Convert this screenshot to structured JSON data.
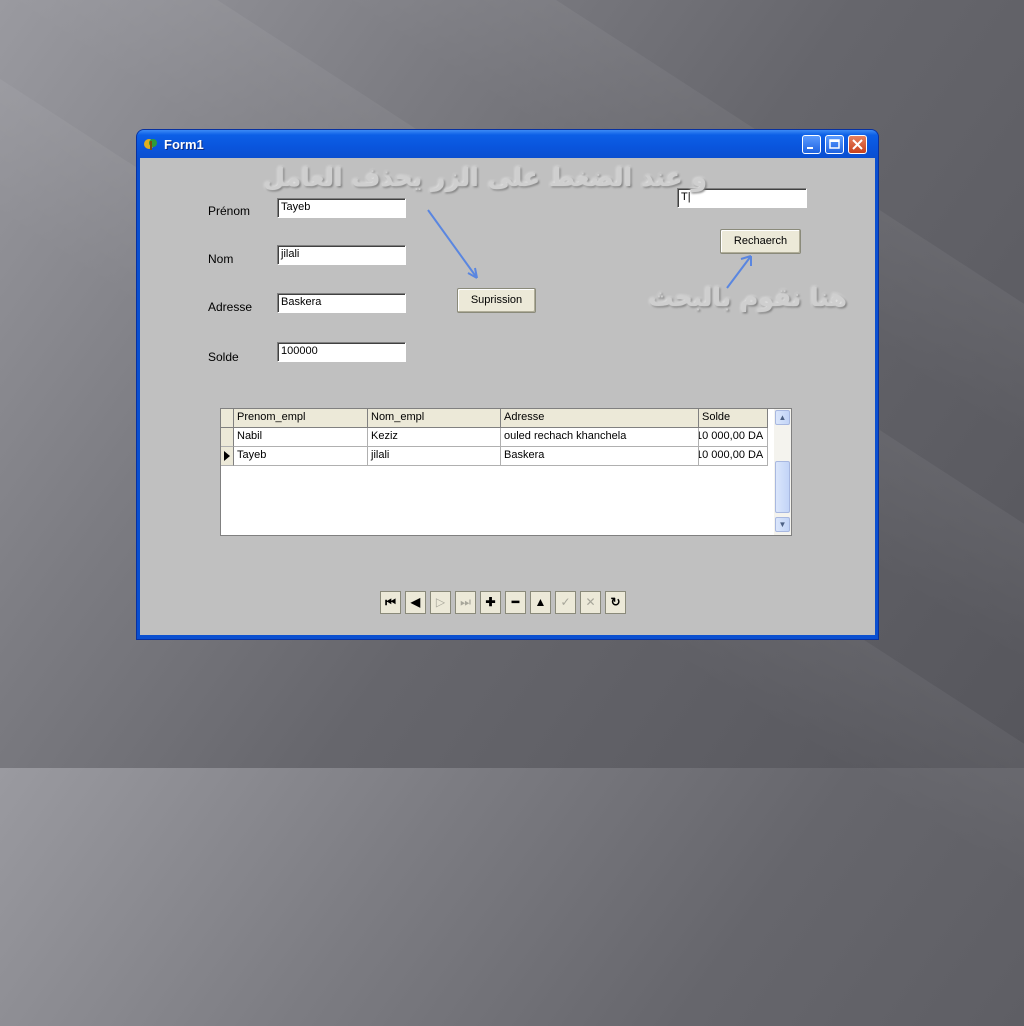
{
  "window": {
    "title": "Form1"
  },
  "form": {
    "prenom_label": "Prénom",
    "prenom_value": "Tayeb",
    "nom_label": "Nom",
    "nom_value": "jilali",
    "adresse_label": "Adresse",
    "adresse_value": "Baskera",
    "solde_label": "Solde",
    "solde_value": "100000",
    "search_value": "T|",
    "suprission_label": "Suprission",
    "recherche_label": "Rechaerch"
  },
  "annotations": {
    "delete_note": "و عند الضغط على الزر يحذف العامل",
    "search_note": "هنا نقوم بالبحث"
  },
  "grid": {
    "columns": [
      "Prenom_empl",
      "Nom_empl",
      "Adresse",
      "Solde"
    ],
    "rows": [
      {
        "prenom": "Nabil",
        "nom": "Keziz",
        "adresse": "ouled rechach khanchela",
        "solde": "10 000,00 DA",
        "current": false
      },
      {
        "prenom": "Tayeb",
        "nom": "jilali",
        "adresse": "Baskera",
        "solde": "10 000,00 DA",
        "current": true
      }
    ]
  },
  "navigator": {
    "buttons": [
      {
        "name": "nav-first-button",
        "glyph": "⏮",
        "enabled": true
      },
      {
        "name": "nav-prior-button",
        "glyph": "◀",
        "enabled": true
      },
      {
        "name": "nav-next-button",
        "glyph": "▷",
        "enabled": false
      },
      {
        "name": "nav-last-button",
        "glyph": "⏭",
        "enabled": false
      },
      {
        "name": "nav-insert-button",
        "glyph": "✚",
        "enabled": true
      },
      {
        "name": "nav-delete-button",
        "glyph": "━",
        "enabled": true
      },
      {
        "name": "nav-edit-button",
        "glyph": "▲",
        "enabled": true
      },
      {
        "name": "nav-post-button",
        "glyph": "✓",
        "enabled": false
      },
      {
        "name": "nav-cancel-button",
        "glyph": "✕",
        "enabled": false
      },
      {
        "name": "nav-refresh-button",
        "glyph": "↻",
        "enabled": true
      }
    ]
  },
  "colors": {
    "titlebar": "#0a55dd",
    "client": "#c0c0c0",
    "arrow": "#5a86e0"
  }
}
